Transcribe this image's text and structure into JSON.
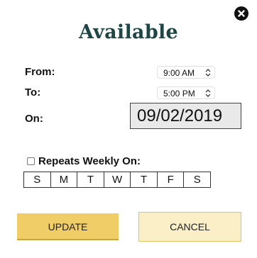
{
  "header": {
    "title": "Available",
    "close_icon": "close-icon"
  },
  "form": {
    "from_label": "From:",
    "from_value": "9:00 AM",
    "to_label": "To:",
    "to_value": "5:00 PM",
    "on_label": "On:",
    "on_value": "09/02/2019"
  },
  "repeat": {
    "label": "Repeats Weekly On:",
    "checked": false,
    "days": [
      "S",
      "M",
      "T",
      "W",
      "T",
      "F",
      "S"
    ]
  },
  "actions": {
    "update_label": "UPDATE",
    "cancel_label": "CANCEL"
  },
  "colors": {
    "title": "#1f4545",
    "update_bg": "#f0cd66",
    "cancel_bg": "#faefc6",
    "cancel_border": "#e2c261",
    "date_bg": "#e9e9e9"
  }
}
